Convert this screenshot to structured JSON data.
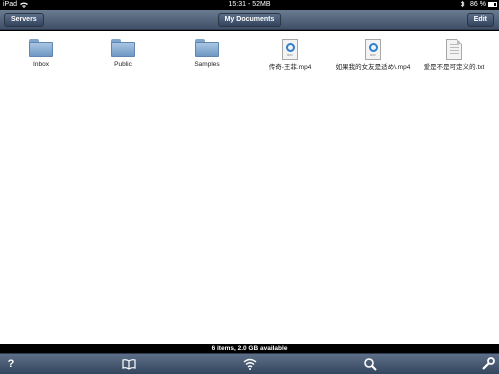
{
  "status_bar": {
    "carrier": "iPad",
    "clock": "15:31 - 52MB",
    "battery": "86 %",
    "icons": [
      "wifi-icon",
      "bluetooth-icon",
      "battery-icon"
    ]
  },
  "nav": {
    "left_button": "Servers",
    "title": "My Documents",
    "right_button": "Edit"
  },
  "items": [
    {
      "label": "Inbox",
      "type": "folder"
    },
    {
      "label": "Public",
      "type": "folder"
    },
    {
      "label": "Samples",
      "type": "folder"
    },
    {
      "label": "传奇-王菲.mp4",
      "type": "video",
      "icon_caption": "MOV"
    },
    {
      "label": "如果我的女友是适め\\.mp4",
      "type": "video",
      "icon_caption": "MOV"
    },
    {
      "label": "爱是不是可定义的.txt",
      "type": "text"
    }
  ],
  "footer": {
    "status": "6 items, 2.0 GB available"
  },
  "toolbar": {
    "icons": [
      "help-icon",
      "bookmarks-icon",
      "wifi-icon",
      "search-icon",
      "settings-icon"
    ],
    "help_glyph": "?"
  },
  "colors": {
    "nav_bar": "#4b5c74",
    "content_bg": "#ffffff",
    "folder_blue": "#8eb3d8",
    "quicktime_blue": "#2f7fd0"
  }
}
